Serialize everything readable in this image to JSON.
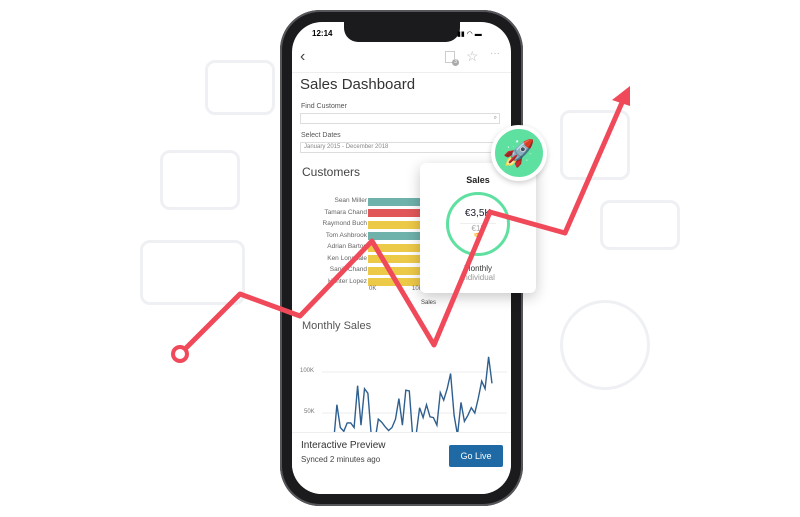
{
  "status_bar": {
    "time": "12:14"
  },
  "nav": {
    "back_icon": "chevron-left-icon",
    "badge_count": "3"
  },
  "title": "Sales Dashboard",
  "filters": {
    "find_customer_label": "Find Customer",
    "find_customer_value": "",
    "select_dates_label": "Select Dates",
    "select_dates_value": "January 2015 - December 2018"
  },
  "customers": {
    "title": "Customers",
    "names": [
      "Sean Miller",
      "Tamara Chand",
      "Raymond Buch",
      "Tom Ashbrook",
      "Adrian Barton",
      "Ken Lonsdale",
      "Sanjit Chand",
      "Hunter Lopez"
    ],
    "bar_colors": [
      "#6fb1ab",
      "#e15759",
      "#edc948",
      "#6fb1ab",
      "#edc948",
      "#edc948",
      "#edc948",
      "#edc948"
    ],
    "x_ticks": [
      "0K",
      "10K"
    ],
    "x_label": "Sales"
  },
  "popup": {
    "title": "Sales",
    "value": "€3,5K",
    "target": "€1k",
    "period": "Monthly",
    "type": "Individual",
    "ring_color": "#5ee0a0"
  },
  "chart_data": {
    "type": "line",
    "title": "Monthly Sales",
    "y_ticks": [
      "100K",
      "50K",
      "0K"
    ],
    "ylim": [
      0,
      110000
    ],
    "color": "#2e5f8f",
    "values_k": [
      10,
      5,
      57,
      27,
      22,
      33,
      33,
      27,
      82,
      30,
      78,
      72,
      14,
      8,
      38,
      34,
      28,
      23,
      27,
      38,
      65,
      30,
      76,
      75,
      15,
      18,
      53,
      40,
      57,
      41,
      40,
      30,
      73,
      63,
      78,
      98,
      43,
      17,
      60,
      35,
      43,
      53,
      46,
      65,
      88,
      78,
      120,
      85
    ]
  },
  "footer": {
    "title": "Interactive Preview",
    "synced": "Synced 2 minutes ago",
    "go_live": "Go Live"
  },
  "accent": {
    "trend": "#f04a5a"
  }
}
